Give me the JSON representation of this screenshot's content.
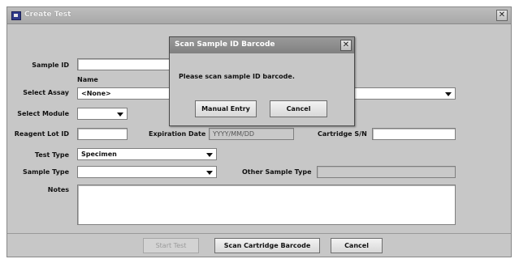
{
  "window": {
    "title": "Create Test",
    "close_glyph": "✕"
  },
  "form": {
    "sample_id_label": "Sample ID",
    "sample_id_value": "",
    "name_header": "Name",
    "select_assay_label": "Select Assay",
    "select_assay_value": "<None>",
    "select_module_label": "Select Module",
    "select_module_value": "",
    "reagent_lot_label": "Reagent Lot ID",
    "reagent_lot_value": "",
    "expiration_label": "Expiration Date",
    "expiration_value": "YYYY/MM/DD",
    "cartridge_label": "Cartridge S/N",
    "cartridge_value": "",
    "test_type_label": "Test Type",
    "test_type_value": "Specimen",
    "sample_type_label": "Sample Type",
    "sample_type_value": "",
    "other_sample_type_label": "Other Sample Type",
    "other_sample_type_value": "",
    "notes_label": "Notes",
    "notes_value": ""
  },
  "footer": {
    "start_test_label": "Start Test",
    "scan_cartridge_label": "Scan Cartridge Barcode",
    "cancel_label": "Cancel"
  },
  "dialog": {
    "title": "Scan Sample ID Barcode",
    "close_glyph": "✕",
    "message": "Please scan sample ID barcode.",
    "manual_entry_label": "Manual Entry",
    "cancel_label": "Cancel"
  }
}
